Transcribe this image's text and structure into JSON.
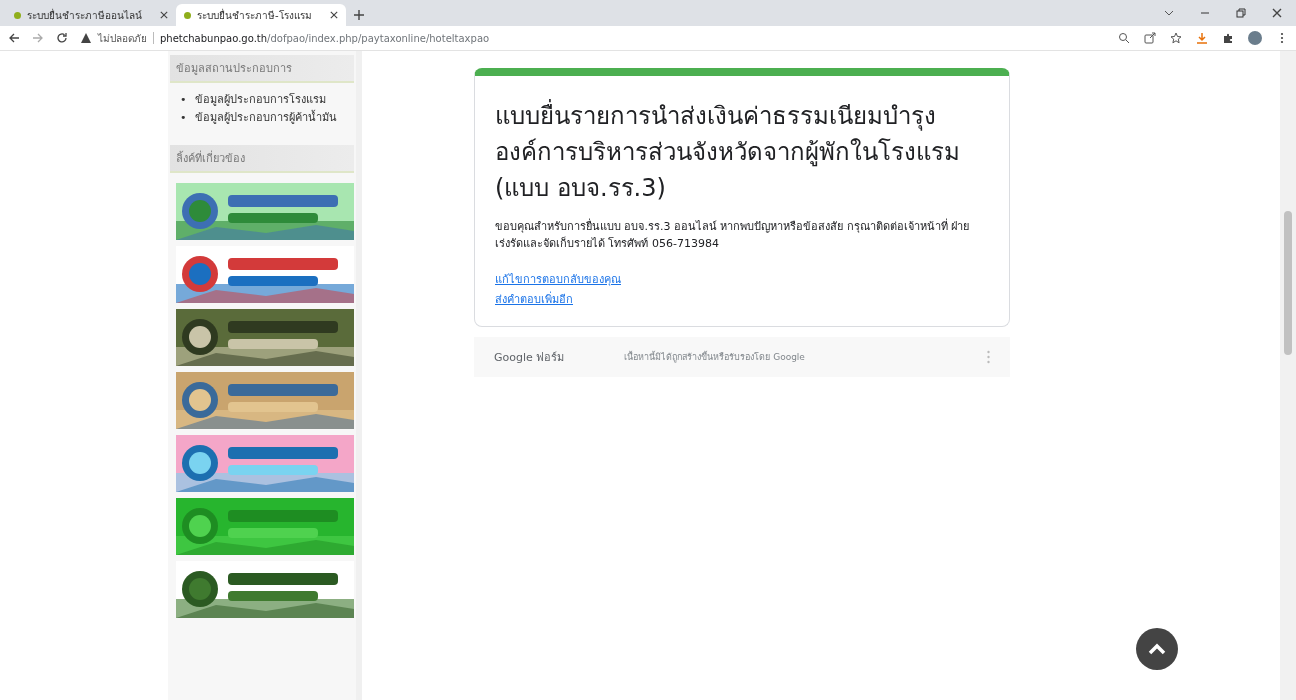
{
  "browser": {
    "tabs": [
      {
        "title": "ระบบยื่นชำระภาษีออนไลน์",
        "selected": false
      },
      {
        "title": "ระบบยื่นชำระภาษี-โรงแรม",
        "selected": true
      }
    ],
    "address": {
      "security_label": "ไม่ปลอดภัย",
      "domain": "phetchabunpao.go.th",
      "path": "/dofpao/index.php/paytaxonline/hoteltaxpao"
    }
  },
  "sidebar": {
    "sections": [
      {
        "heading": "ข้อมูลสถานประกอบการ",
        "items": [
          {
            "bullet": "•",
            "label": "ข้อมูลผู้ประกอบการโรงแรม"
          },
          {
            "bullet": "•",
            "label": "ข้อมูลผู้ประกอบการผู้ค้าน้ำมัน"
          }
        ]
      }
    ],
    "links_heading": "ลิ้งค์ที่เกี่ยวข้อง"
  },
  "form": {
    "title": "แบบยื่นรายการนำส่งเงินค่าธรรมเนียมบำรุงองค์การบริหารส่วนจังหวัดจากผู้พักในโรงแรม (แบบ อบจ.รร.3)",
    "message": "ขอบคุณสำหรับการยื่นแบบ อบจ.รร.3 ออนไลน์ หากพบปัญหาหรือข้อสงสัย กรุณาติดต่อเจ้าหน้าที่ ฝ่ายเร่งรัดและจัดเก็บรายได้ โทรศัพท์ 056-713984",
    "links": [
      "แก้ไขการตอบกลับของคุณ",
      "ส่งคำตอบเพิ่มอีก"
    ],
    "footer": {
      "brand": "Google",
      "product": "ฟอร์ม",
      "disclaimer": "เนื้อหานี้มิได้ถูกสร้างขึ้นหรือรับรองโดย Google"
    }
  }
}
